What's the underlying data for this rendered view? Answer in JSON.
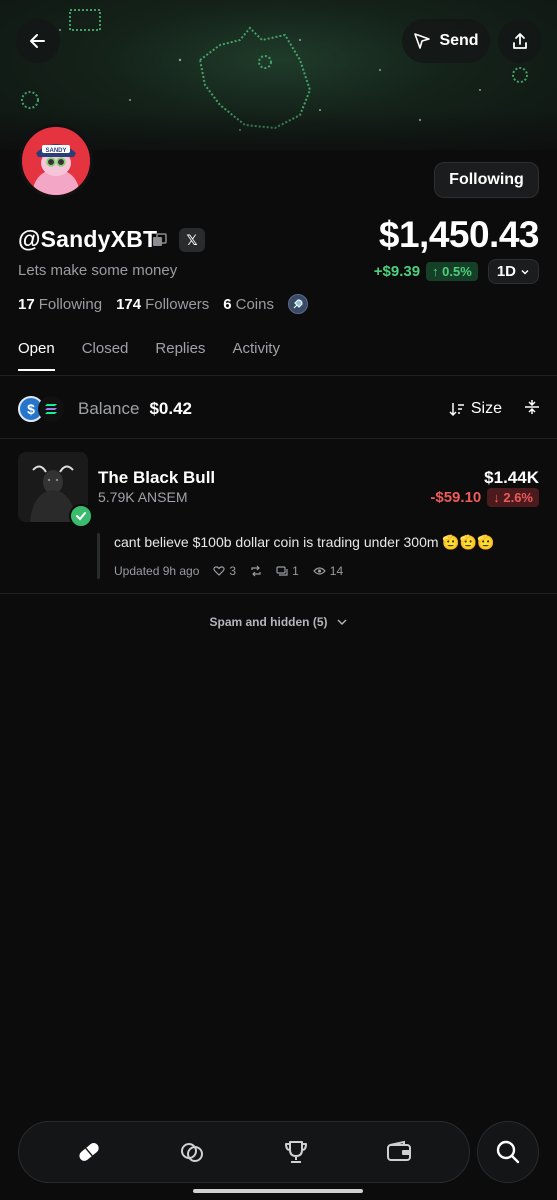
{
  "header": {
    "send_label": "Send"
  },
  "profile": {
    "handle": "@SandyXBT",
    "avatar_text": "SANDY",
    "bio": "Lets make some money",
    "following_button": "Following",
    "x_badge": "𝕏",
    "stats": {
      "following_count": "17",
      "following_label": "Following",
      "followers_count": "174",
      "followers_label": "Followers",
      "coins_count": "6",
      "coins_label": "Coins"
    }
  },
  "portfolio": {
    "value": "$1,450.43",
    "change": "+$9.39",
    "change_pct": "↑ 0.5%",
    "period": "1D",
    "positive_color": "#4cd07d"
  },
  "tabs": [
    {
      "label": "Open"
    },
    {
      "label": "Closed"
    },
    {
      "label": "Replies"
    },
    {
      "label": "Activity"
    }
  ],
  "balance": {
    "label": "Balance",
    "value": "$0.42",
    "sort_label": "Size"
  },
  "holdings": [
    {
      "name": "The Black Bull",
      "amount": "5.79K ANSEM",
      "value": "$1.44K",
      "change": "-$59.10",
      "change_pct": "↓ 2.6%",
      "reply": {
        "text": "cant believe $100b dollar coin is trading under 300m 🫡🫡🫡",
        "updated": "Updated 9h ago",
        "likes": "3",
        "replies": "1",
        "views": "14"
      }
    }
  ],
  "spam": {
    "label": "Spam and hidden (5)"
  },
  "nav": {
    "items": [
      "pill-icon",
      "coins-icon",
      "trophy-icon",
      "wallet-icon"
    ],
    "search": "search-icon"
  },
  "colors": {
    "accent_green": "#4cd07d",
    "negative_red": "#ef5a5a",
    "background": "#0c0c0d"
  }
}
